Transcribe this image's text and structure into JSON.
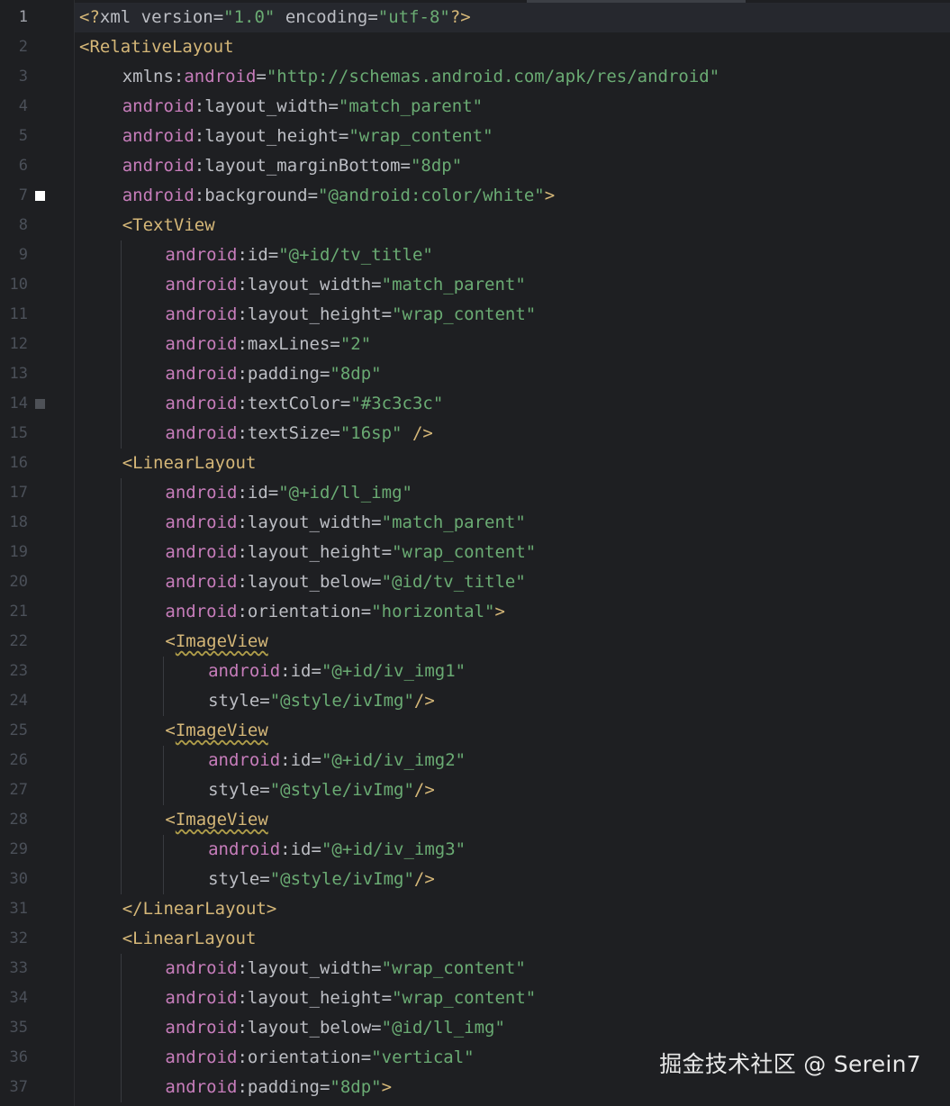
{
  "editor": {
    "language": "xml",
    "current_line": 1,
    "lines": [
      {
        "n": "1",
        "indent": 0,
        "marker": "",
        "tokens": [
          {
            "t": "punct",
            "v": "<?"
          },
          {
            "t": "plain",
            "v": "xml version="
          },
          {
            "t": "str",
            "v": "\"1.0\""
          },
          {
            "t": "plain",
            "v": " encoding="
          },
          {
            "t": "str",
            "v": "\"utf-8\""
          },
          {
            "t": "punct",
            "v": "?>"
          }
        ]
      },
      {
        "n": "2",
        "indent": 0,
        "marker": "",
        "tokens": [
          {
            "t": "tag",
            "v": "<RelativeLayout"
          }
        ]
      },
      {
        "n": "3",
        "indent": 1,
        "marker": "",
        "tokens": [
          {
            "t": "attr",
            "v": "xmlns:"
          },
          {
            "t": "ns",
            "v": "android"
          },
          {
            "t": "attr",
            "v": "="
          },
          {
            "t": "str",
            "v": "\"http://schemas.android.com/apk/res/android\""
          }
        ]
      },
      {
        "n": "4",
        "indent": 1,
        "marker": "",
        "tokens": [
          {
            "t": "ns",
            "v": "android"
          },
          {
            "t": "attr",
            "v": ":layout_width="
          },
          {
            "t": "str",
            "v": "\"match_parent\""
          }
        ]
      },
      {
        "n": "5",
        "indent": 1,
        "marker": "",
        "tokens": [
          {
            "t": "ns",
            "v": "android"
          },
          {
            "t": "attr",
            "v": ":layout_height="
          },
          {
            "t": "str",
            "v": "\"wrap_content\""
          }
        ]
      },
      {
        "n": "6",
        "indent": 1,
        "marker": "",
        "tokens": [
          {
            "t": "ns",
            "v": "android"
          },
          {
            "t": "attr",
            "v": ":layout_marginBottom="
          },
          {
            "t": "str",
            "v": "\"8dp\""
          }
        ]
      },
      {
        "n": "7",
        "indent": 1,
        "marker": "white",
        "tokens": [
          {
            "t": "ns",
            "v": "android"
          },
          {
            "t": "attr",
            "v": ":background="
          },
          {
            "t": "str",
            "v": "\"@android:color/white\""
          },
          {
            "t": "tag",
            "v": ">"
          }
        ]
      },
      {
        "n": "8",
        "indent": 1,
        "marker": "",
        "tokens": [
          {
            "t": "tag",
            "v": "<TextView"
          }
        ]
      },
      {
        "n": "9",
        "indent": 2,
        "marker": "",
        "tokens": [
          {
            "t": "ns",
            "v": "android"
          },
          {
            "t": "attr",
            "v": ":id="
          },
          {
            "t": "str",
            "v": "\"@+id/tv_title\""
          }
        ]
      },
      {
        "n": "10",
        "indent": 2,
        "marker": "",
        "tokens": [
          {
            "t": "ns",
            "v": "android"
          },
          {
            "t": "attr",
            "v": ":layout_width="
          },
          {
            "t": "str",
            "v": "\"match_parent\""
          }
        ]
      },
      {
        "n": "11",
        "indent": 2,
        "marker": "",
        "tokens": [
          {
            "t": "ns",
            "v": "android"
          },
          {
            "t": "attr",
            "v": ":layout_height="
          },
          {
            "t": "str",
            "v": "\"wrap_content\""
          }
        ]
      },
      {
        "n": "12",
        "indent": 2,
        "marker": "",
        "tokens": [
          {
            "t": "ns",
            "v": "android"
          },
          {
            "t": "attr",
            "v": ":maxLines="
          },
          {
            "t": "str",
            "v": "\"2\""
          }
        ]
      },
      {
        "n": "13",
        "indent": 2,
        "marker": "",
        "tokens": [
          {
            "t": "ns",
            "v": "android"
          },
          {
            "t": "attr",
            "v": ":padding="
          },
          {
            "t": "str",
            "v": "\"8dp\""
          }
        ]
      },
      {
        "n": "14",
        "indent": 2,
        "marker": "gray",
        "tokens": [
          {
            "t": "ns",
            "v": "android"
          },
          {
            "t": "attr",
            "v": ":textColor="
          },
          {
            "t": "str",
            "v": "\"#3c3c3c\""
          }
        ]
      },
      {
        "n": "15",
        "indent": 2,
        "marker": "",
        "tokens": [
          {
            "t": "ns",
            "v": "android"
          },
          {
            "t": "attr",
            "v": ":textSize="
          },
          {
            "t": "str",
            "v": "\"16sp\""
          },
          {
            "t": "tag",
            "v": " />"
          }
        ]
      },
      {
        "n": "16",
        "indent": 1,
        "marker": "",
        "tokens": [
          {
            "t": "tag",
            "v": "<LinearLayout"
          }
        ]
      },
      {
        "n": "17",
        "indent": 2,
        "marker": "",
        "tokens": [
          {
            "t": "ns",
            "v": "android"
          },
          {
            "t": "attr",
            "v": ":id="
          },
          {
            "t": "str",
            "v": "\"@+id/ll_img\""
          }
        ]
      },
      {
        "n": "18",
        "indent": 2,
        "marker": "",
        "tokens": [
          {
            "t": "ns",
            "v": "android"
          },
          {
            "t": "attr",
            "v": ":layout_width="
          },
          {
            "t": "str",
            "v": "\"match_parent\""
          }
        ]
      },
      {
        "n": "19",
        "indent": 2,
        "marker": "",
        "tokens": [
          {
            "t": "ns",
            "v": "android"
          },
          {
            "t": "attr",
            "v": ":layout_height="
          },
          {
            "t": "str",
            "v": "\"wrap_content\""
          }
        ]
      },
      {
        "n": "20",
        "indent": 2,
        "marker": "",
        "tokens": [
          {
            "t": "ns",
            "v": "android"
          },
          {
            "t": "attr",
            "v": ":layout_below="
          },
          {
            "t": "str",
            "v": "\"@id/tv_title\""
          }
        ]
      },
      {
        "n": "21",
        "indent": 2,
        "marker": "",
        "tokens": [
          {
            "t": "ns",
            "v": "android"
          },
          {
            "t": "attr",
            "v": ":orientation="
          },
          {
            "t": "str",
            "v": "\"horizontal\""
          },
          {
            "t": "tag",
            "v": ">"
          }
        ]
      },
      {
        "n": "22",
        "indent": 2,
        "marker": "",
        "tokens": [
          {
            "t": "tag",
            "v": "<"
          },
          {
            "t": "tagwarn",
            "v": "ImageView"
          }
        ]
      },
      {
        "n": "23",
        "indent": 3,
        "marker": "",
        "tokens": [
          {
            "t": "ns",
            "v": "android"
          },
          {
            "t": "attr",
            "v": ":id="
          },
          {
            "t": "str",
            "v": "\"@+id/iv_img1\""
          }
        ]
      },
      {
        "n": "24",
        "indent": 3,
        "marker": "",
        "tokens": [
          {
            "t": "attr",
            "v": "style="
          },
          {
            "t": "str",
            "v": "\"@style/ivImg\""
          },
          {
            "t": "tag",
            "v": "/>"
          }
        ]
      },
      {
        "n": "25",
        "indent": 2,
        "marker": "",
        "tokens": [
          {
            "t": "tag",
            "v": "<"
          },
          {
            "t": "tagwarn",
            "v": "ImageView"
          }
        ]
      },
      {
        "n": "26",
        "indent": 3,
        "marker": "",
        "tokens": [
          {
            "t": "ns",
            "v": "android"
          },
          {
            "t": "attr",
            "v": ":id="
          },
          {
            "t": "str",
            "v": "\"@+id/iv_img2\""
          }
        ]
      },
      {
        "n": "27",
        "indent": 3,
        "marker": "",
        "tokens": [
          {
            "t": "attr",
            "v": "style="
          },
          {
            "t": "str",
            "v": "\"@style/ivImg\""
          },
          {
            "t": "tag",
            "v": "/>"
          }
        ]
      },
      {
        "n": "28",
        "indent": 2,
        "marker": "",
        "tokens": [
          {
            "t": "tag",
            "v": "<"
          },
          {
            "t": "tagwarn",
            "v": "ImageView"
          }
        ]
      },
      {
        "n": "29",
        "indent": 3,
        "marker": "",
        "tokens": [
          {
            "t": "ns",
            "v": "android"
          },
          {
            "t": "attr",
            "v": ":id="
          },
          {
            "t": "str",
            "v": "\"@+id/iv_img3\""
          }
        ]
      },
      {
        "n": "30",
        "indent": 3,
        "marker": "",
        "tokens": [
          {
            "t": "attr",
            "v": "style="
          },
          {
            "t": "str",
            "v": "\"@style/ivImg\""
          },
          {
            "t": "tag",
            "v": "/>"
          }
        ]
      },
      {
        "n": "31",
        "indent": 1,
        "marker": "",
        "tokens": [
          {
            "t": "tag",
            "v": "</LinearLayout>"
          }
        ]
      },
      {
        "n": "32",
        "indent": 1,
        "marker": "",
        "tokens": [
          {
            "t": "tag",
            "v": "<LinearLayout"
          }
        ]
      },
      {
        "n": "33",
        "indent": 2,
        "marker": "",
        "tokens": [
          {
            "t": "ns",
            "v": "android"
          },
          {
            "t": "attr",
            "v": ":layout_width="
          },
          {
            "t": "str",
            "v": "\"wrap_content\""
          }
        ]
      },
      {
        "n": "34",
        "indent": 2,
        "marker": "",
        "tokens": [
          {
            "t": "ns",
            "v": "android"
          },
          {
            "t": "attr",
            "v": ":layout_height="
          },
          {
            "t": "str",
            "v": "\"wrap_content\""
          }
        ]
      },
      {
        "n": "35",
        "indent": 2,
        "marker": "",
        "tokens": [
          {
            "t": "ns",
            "v": "android"
          },
          {
            "t": "attr",
            "v": ":layout_below="
          },
          {
            "t": "str",
            "v": "\"@id/ll_img\""
          }
        ]
      },
      {
        "n": "36",
        "indent": 2,
        "marker": "",
        "tokens": [
          {
            "t": "ns",
            "v": "android"
          },
          {
            "t": "attr",
            "v": ":orientation="
          },
          {
            "t": "str",
            "v": "\"vertical\""
          }
        ]
      },
      {
        "n": "37",
        "indent": 2,
        "marker": "",
        "tokens": [
          {
            "t": "ns",
            "v": "android"
          },
          {
            "t": "attr",
            "v": ":padding="
          },
          {
            "t": "str",
            "v": "\"8dp\""
          },
          {
            "t": "tag",
            "v": ">"
          }
        ]
      }
    ]
  },
  "watermark": "掘金技术社区 @ Serein7",
  "colors": {
    "background": "#1e1f22",
    "tag": "#d5b778",
    "namespace": "#c77dbb",
    "attribute": "#bcbec4",
    "string": "#6aab73",
    "line_number": "#4b5059"
  }
}
